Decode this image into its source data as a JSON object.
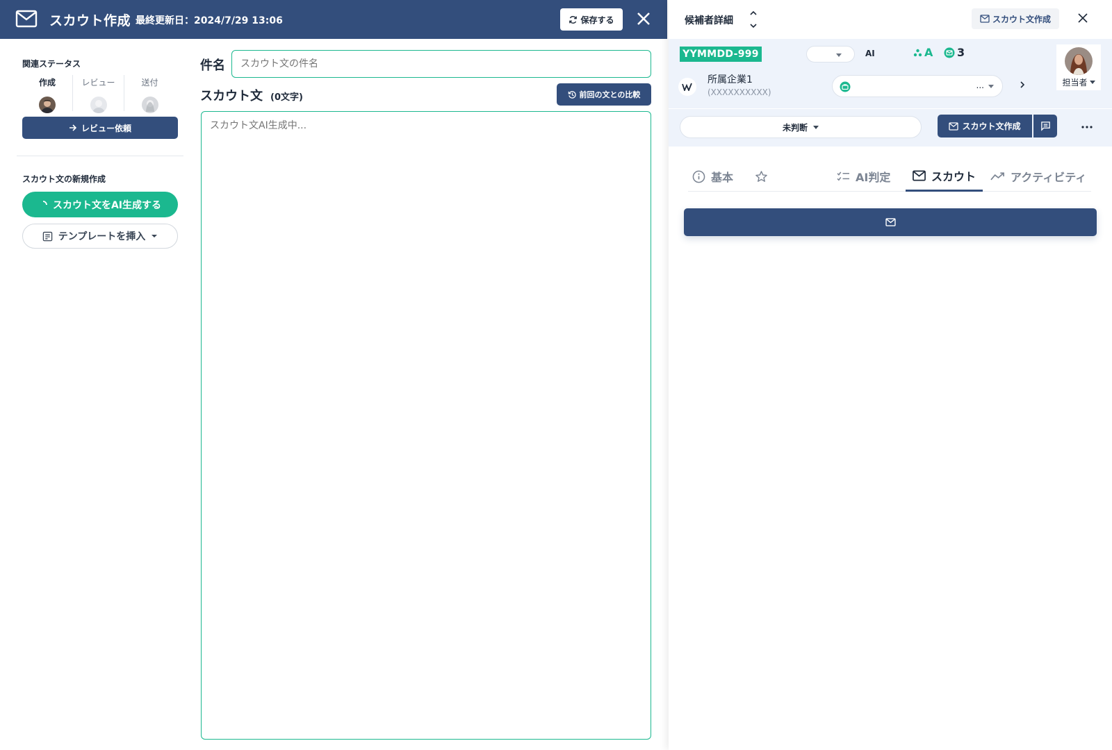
{
  "left": {
    "header": {
      "title": "スカウト作成",
      "updated": "最終更新日：2024/7/29 13:06",
      "save_label": "保存する"
    },
    "sidebar": {
      "status_title": "関連ステータス",
      "status": [
        "作成",
        "レビュー",
        "送付"
      ],
      "review_request_label": "レビュー依頼",
      "new_title": "スカウト文の新規作成",
      "ai_generate_label": "スカウト文をAI生成する",
      "template_label": "テンプレートを挿入"
    },
    "editor": {
      "subject_label": "件名",
      "subject_placeholder": "スカウト文の件名",
      "body_label": "スカウト文",
      "char_count": "(0文字)",
      "compare_label": "前回の文との比較",
      "body_placeholder": "スカウト文AI生成中..."
    }
  },
  "right": {
    "header": {
      "title": "候補者詳細",
      "scout_create_label": "スカウト文作成"
    },
    "candidate": {
      "id": "YYMMDD-999",
      "ai_label": "AI",
      "grade": "A",
      "message_count": "3",
      "owner_label": "担当者",
      "company_name": "所属企業1",
      "company_sub": "(XXXXXXXXXX)",
      "select_dots": "..."
    },
    "actions": {
      "judgement": "未判断",
      "scout_create_label": "スカウト文作成"
    },
    "tabs": [
      {
        "label": "基本",
        "icon": "info-icon"
      },
      {
        "label": "",
        "icon": "star-icon"
      },
      {
        "label": "AI判定",
        "icon": "checklist-icon"
      },
      {
        "label": "スカウト",
        "icon": "mail-icon"
      },
      {
        "label": "アクティビティ",
        "icon": "trend-icon"
      }
    ],
    "active_tab": "スカウト"
  },
  "colors": {
    "primary": "#334e7c",
    "accent": "#1bb88f",
    "panel_bg": "#eef3fb"
  }
}
